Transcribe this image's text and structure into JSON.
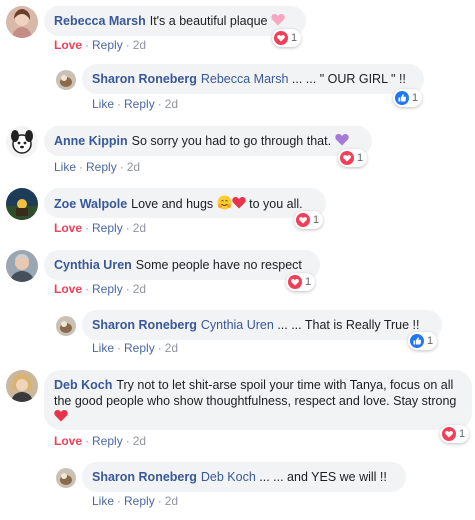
{
  "comments": [
    {
      "author": "Rebecca Marsh",
      "text": "It's a beautiful plaque",
      "action": "Love",
      "reply_label": "Reply",
      "time": "2d",
      "reaction_count": "1",
      "reaction_icon": "love-icon",
      "avatar": "woman-portrait"
    },
    {
      "author": "Sharon Roneberg",
      "mention": "Rebecca Marsh",
      "text": "... ... \" OUR GIRL \" !!",
      "action": "Like",
      "reply_label": "Reply",
      "time": "2d",
      "reaction_count": "1",
      "reaction_icon": "like-icon",
      "avatar": "dog-photo"
    },
    {
      "author": "Anne Kippin",
      "text": "So sorry you had to go through that.",
      "action": "Like",
      "reply_label": "Reply",
      "time": "2d",
      "reaction_count": "1",
      "reaction_icon": "love-icon",
      "avatar": "cartoon-dog"
    },
    {
      "author": "Zoe Walpole",
      "text": "Love and hugs",
      "text_after": "to you all.",
      "action": "Love",
      "reply_label": "Reply",
      "time": "2d",
      "reaction_count": "1",
      "reaction_icon": "love-icon",
      "avatar": "landscape-photo"
    },
    {
      "author": "Cynthia Uren",
      "text": "Some people have no respect",
      "action": "Love",
      "reply_label": "Reply",
      "time": "2d",
      "reaction_count": "1",
      "reaction_icon": "love-icon",
      "avatar": "man-portrait"
    },
    {
      "author": "Sharon Roneberg",
      "mention": "Cynthia Uren",
      "text": "... ... That is Really True !!",
      "action": "Like",
      "reply_label": "Reply",
      "time": "2d",
      "reaction_count": "1",
      "reaction_icon": "like-icon",
      "avatar": "dog-photo"
    },
    {
      "author": "Deb Koch",
      "text": "Try not to let shit-arse spoil your time with Tanya, focus on all the good people who show thoughtfulness, respect and love. Stay strong",
      "action": "Love",
      "reply_label": "Reply",
      "time": "2d",
      "reaction_count": "1",
      "reaction_icon": "love-icon",
      "avatar": "woman-blonde"
    },
    {
      "author": "Sharon Roneberg",
      "mention": "Deb Koch",
      "text": "... ... and YES we will !!",
      "action": "Like",
      "reply_label": "Reply",
      "time": "2d",
      "avatar": "dog-photo"
    }
  ],
  "colors": {
    "bubble": "#f2f3f5",
    "author": "#385898",
    "love": "#f33e58",
    "like": "#4b67a1",
    "meta": "#90949c"
  }
}
